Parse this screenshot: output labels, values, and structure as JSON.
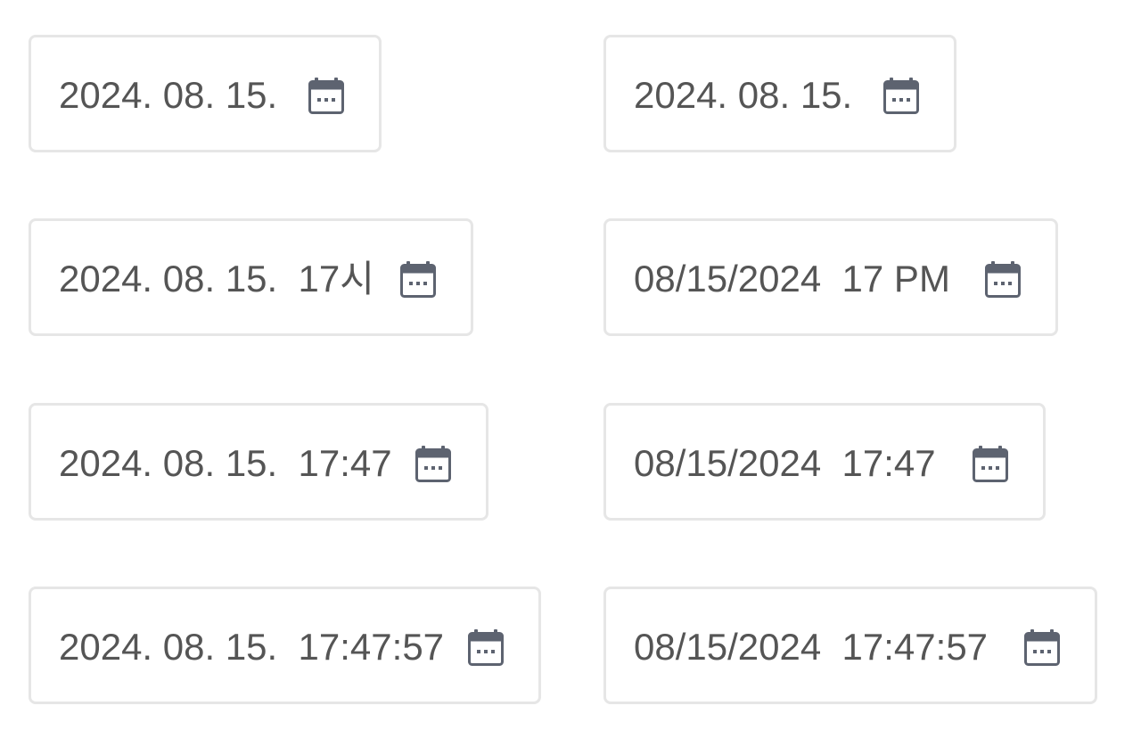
{
  "fields": [
    {
      "value": "2024. 08. 15.",
      "icon": "calendar-icon"
    },
    {
      "value": "2024. 08. 15.",
      "icon": "calendar-icon"
    },
    {
      "value": "2024. 08. 15.  17시",
      "icon": "calendar-icon"
    },
    {
      "value": "08/15/2024  17 PM",
      "icon": "calendar-icon"
    },
    {
      "value": "2024. 08. 15.  17:47",
      "icon": "calendar-icon"
    },
    {
      "value": "08/15/2024  17:47",
      "icon": "calendar-icon"
    },
    {
      "value": "2024. 08. 15.  17:47:57",
      "icon": "calendar-icon"
    },
    {
      "value": "08/15/2024  17:47:57",
      "icon": "calendar-icon"
    }
  ],
  "colors": {
    "border": "#e6e6e6",
    "text": "#555555",
    "icon": "#5d6370"
  }
}
